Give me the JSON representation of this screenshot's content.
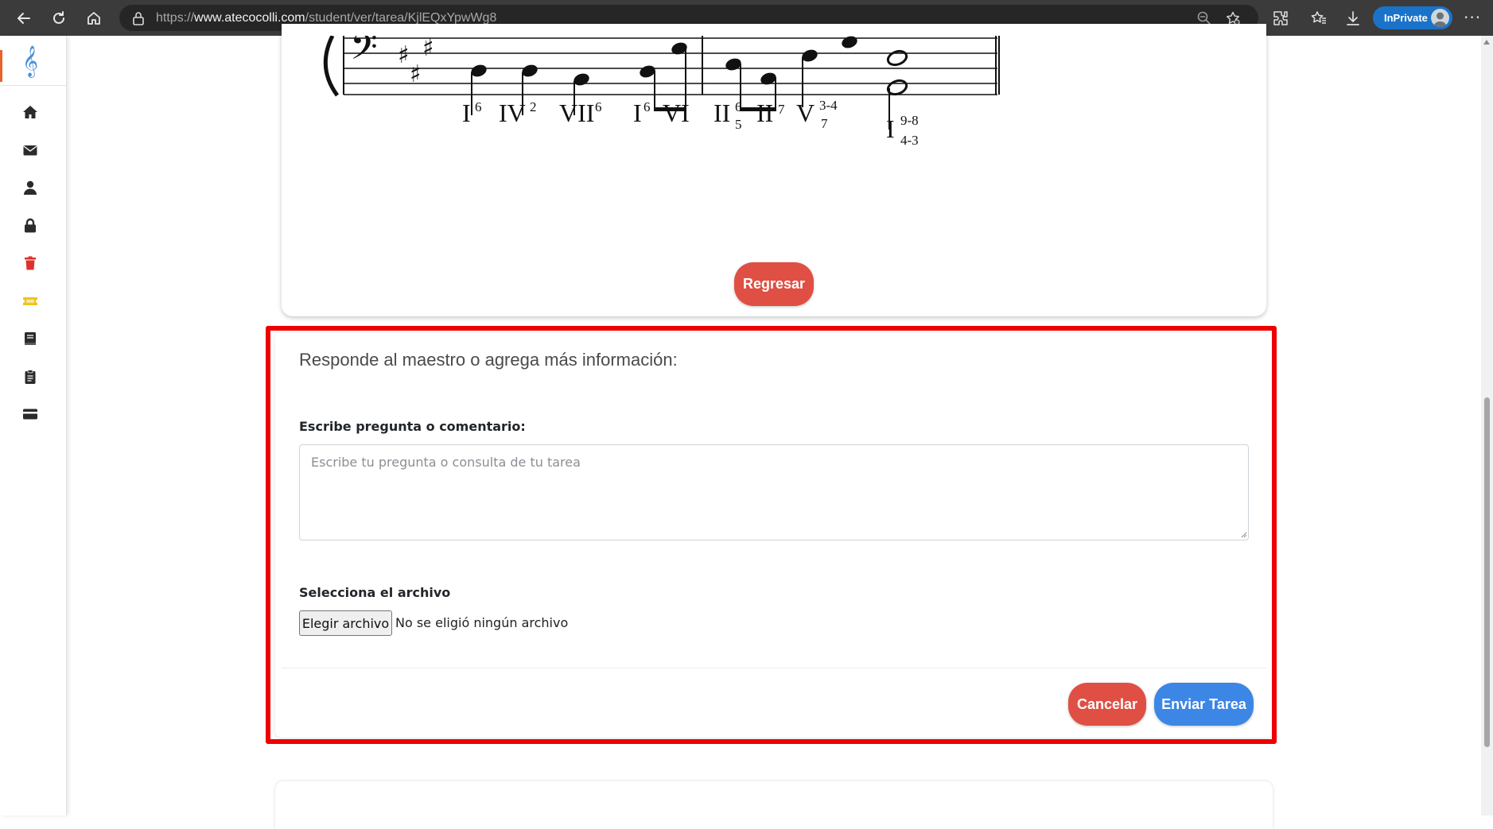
{
  "browser": {
    "url_prefix": "https://",
    "url_host": "www.atecocolli.com",
    "url_path": "/student/ver/tarea/KjlEQxYpwWg8",
    "inprivate_label": "InPrivate"
  },
  "sidebar": {
    "items": [
      {
        "icon": "home-icon",
        "color": "#2b2b2b"
      },
      {
        "icon": "envelope-icon",
        "color": "#2b2b2b"
      },
      {
        "icon": "user-icon",
        "color": "#2b2b2b"
      },
      {
        "icon": "lock-icon",
        "color": "#2b2b2b"
      },
      {
        "icon": "trash-icon",
        "color": "#e0302b"
      },
      {
        "icon": "ticket-icon",
        "color": "#f0c419"
      },
      {
        "icon": "book-icon",
        "color": "#2b2b2b"
      },
      {
        "icon": "clipboard-icon",
        "color": "#2b2b2b"
      },
      {
        "icon": "credit-card-icon",
        "color": "#2b2b2b"
      }
    ]
  },
  "score": {
    "chords": [
      "I",
      "IV",
      "VII",
      "I",
      "VI",
      "II",
      "II",
      "V",
      "I"
    ],
    "figures": [
      "6",
      "2",
      "6",
      "6",
      "6",
      "5",
      "7",
      "3-4",
      "7",
      "9-8",
      "4-3"
    ]
  },
  "main": {
    "back_button": "Regresar",
    "reply_title": "Responde al maestro o agrega más información:",
    "comment_label": "Escribe pregunta o comentario:",
    "comment_placeholder": "Escribe tu pregunta o consulta de tu tarea",
    "comment_value": "",
    "file_label": "Selecciona el archivo",
    "file_button": "Elegir archivo",
    "file_status": "No se eligió ningún archivo",
    "cancel_button": "Cancelar",
    "submit_button": "Enviar Tarea"
  },
  "colors": {
    "red_button": "#e04f44",
    "blue_button": "#3c86e6",
    "highlight": "#ee0000",
    "browser_bar": "#3b3b3b",
    "inprivate": "#1a73c9"
  }
}
